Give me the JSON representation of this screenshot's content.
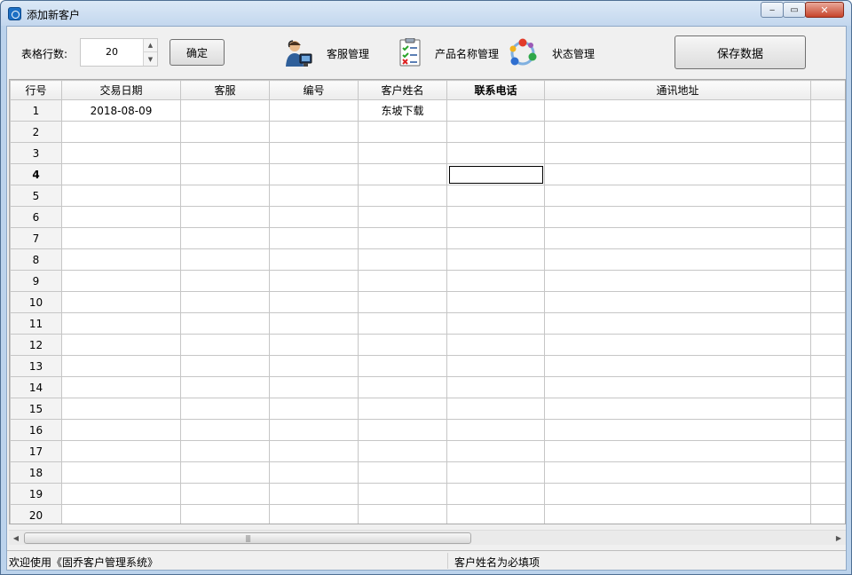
{
  "window": {
    "title": "添加新客户",
    "minimize": "‒",
    "maximize": "▭",
    "close": "✕"
  },
  "toolbar": {
    "rows_label": "表格行数:",
    "rows_value": "20",
    "ok_label": "确定",
    "tools": [
      {
        "label": "客服管理",
        "icon": "customer-service-icon"
      },
      {
        "label": "产品名称管理",
        "icon": "checklist-icon"
      },
      {
        "label": "状态管理",
        "icon": "status-cycle-icon"
      }
    ],
    "save_label": "保存数据"
  },
  "grid": {
    "columns": [
      "行号",
      "交易日期",
      "客服",
      "编号",
      "客户姓名",
      "联系电话",
      "通讯地址"
    ],
    "rows": [
      [
        "1",
        "2018-08-09",
        "",
        "",
        "东坡下载",
        "",
        ""
      ],
      [
        "2",
        "",
        "",
        "",
        "",
        "",
        ""
      ],
      [
        "3",
        "",
        "",
        "",
        "",
        "",
        ""
      ],
      [
        "4",
        "",
        "",
        "",
        "",
        "",
        ""
      ],
      [
        "5",
        "",
        "",
        "",
        "",
        "",
        ""
      ],
      [
        "6",
        "",
        "",
        "",
        "",
        "",
        ""
      ],
      [
        "7",
        "",
        "",
        "",
        "",
        "",
        ""
      ],
      [
        "8",
        "",
        "",
        "",
        "",
        "",
        ""
      ],
      [
        "9",
        "",
        "",
        "",
        "",
        "",
        ""
      ],
      [
        "10",
        "",
        "",
        "",
        "",
        "",
        ""
      ],
      [
        "11",
        "",
        "",
        "",
        "",
        "",
        ""
      ],
      [
        "12",
        "",
        "",
        "",
        "",
        "",
        ""
      ],
      [
        "13",
        "",
        "",
        "",
        "",
        "",
        ""
      ],
      [
        "14",
        "",
        "",
        "",
        "",
        "",
        ""
      ],
      [
        "15",
        "",
        "",
        "",
        "",
        "",
        ""
      ],
      [
        "16",
        "",
        "",
        "",
        "",
        "",
        ""
      ],
      [
        "17",
        "",
        "",
        "",
        "",
        "",
        ""
      ],
      [
        "18",
        "",
        "",
        "",
        "",
        "",
        ""
      ],
      [
        "19",
        "",
        "",
        "",
        "",
        "",
        ""
      ],
      [
        "20",
        "",
        "",
        "",
        "",
        "",
        ""
      ]
    ],
    "current_row": "4",
    "selected_column": "联系电话"
  },
  "statusbar": {
    "welcome": "欢迎使用《固乔客户管理系统》",
    "hint": "客户姓名为必填项"
  }
}
